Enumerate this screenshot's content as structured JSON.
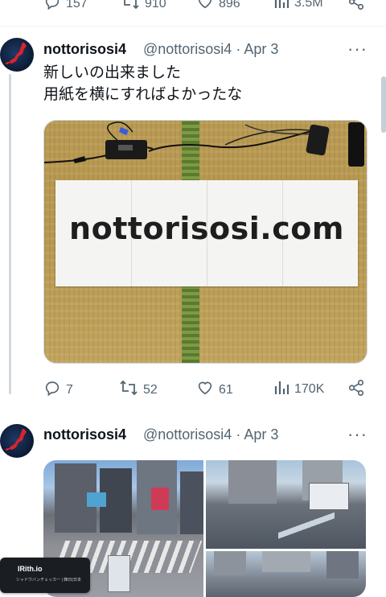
{
  "prev_actions": {
    "reply_count": "157",
    "retweet_count": "910",
    "like_count": "896",
    "view_count": "3.5M"
  },
  "tweet1": {
    "display_name": "nottorisosi4",
    "handle": "@nottorisosi4",
    "separator": "·",
    "date": "Apr 3",
    "more": "···",
    "text_line1": "新しいの出来ました",
    "text_line2": "用紙を横にすればよかったな",
    "photo_banner_text": "nottorisosi.com",
    "reply_count": "7",
    "retweet_count": "52",
    "like_count": "61",
    "view_count": "170K"
  },
  "tweet2": {
    "display_name": "nottorisosi4",
    "handle": "@nottorisosi4",
    "separator": "·",
    "date": "Apr 3",
    "more": "···",
    "overlay_title": "IRith.io",
    "overlay_sub": "シャドウバンチェッカー | 韓日(日本"
  },
  "colors": {
    "text_primary": "#0f1419",
    "text_secondary": "#536471",
    "thread_line": "#cfd9de"
  }
}
